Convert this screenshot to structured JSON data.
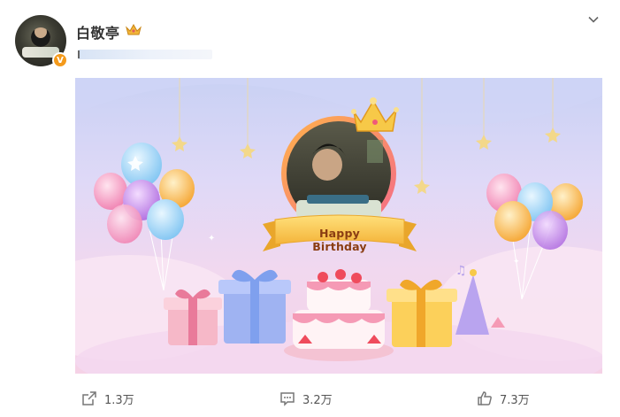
{
  "post": {
    "username": "白敬亭",
    "verified_badge": "V",
    "crown_badge": "crown-badge-icon",
    "banner_text": "Happy Birthday"
  },
  "actions": {
    "share_count": "1.3万",
    "comment_count": "3.2万",
    "like_count": "7.3万"
  },
  "colors": {
    "verified": "#f49a1b",
    "ribbon": "#f6c64a",
    "ribbon_text": "#8a3d12",
    "banner_top": "#c9d1f4",
    "banner_bottom": "#f5d2e6"
  }
}
